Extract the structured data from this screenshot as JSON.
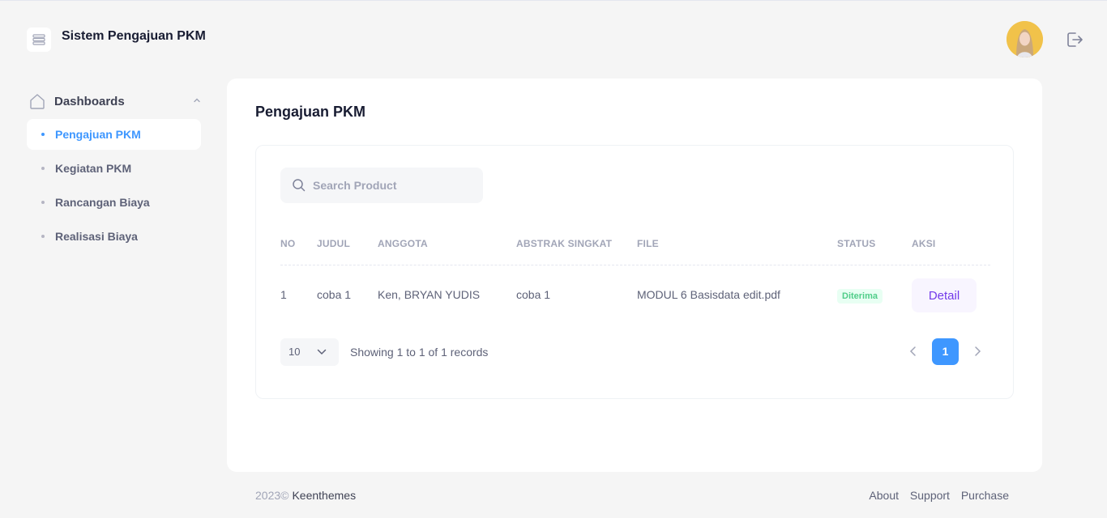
{
  "header": {
    "app_title": "Sistem Pengajuan PKM",
    "menu_icon": "menu-icon",
    "avatar_icon": "avatar",
    "logout_icon": "logout-icon"
  },
  "sidebar": {
    "section": {
      "label": "Dashboards",
      "icon": "home-icon"
    },
    "items": [
      {
        "label": "Pengajuan PKM",
        "active": true
      },
      {
        "label": "Kegiatan PKM",
        "active": false
      },
      {
        "label": "Rancangan Biaya",
        "active": false
      },
      {
        "label": "Realisasi Biaya",
        "active": false
      }
    ]
  },
  "main": {
    "title": "Pengajuan PKM",
    "search": {
      "placeholder": "Search Product",
      "value": ""
    },
    "table": {
      "headers": [
        "NO",
        "JUDUL",
        "ANGGOTA",
        "ABSTRAK SINGKAT",
        "FILE",
        "STATUS",
        "AKSI"
      ],
      "rows": [
        {
          "no": "1",
          "judul": "coba 1",
          "anggota": "Ken, BRYAN YUDIS",
          "abstrak": "coba 1",
          "file": "MODUL 6 Basisdata edit.pdf",
          "status": "Diterima",
          "aksi": "Detail"
        }
      ]
    },
    "pagination": {
      "page_size": "10",
      "records_text": "Showing 1 to 1 of 1 records",
      "current_page": "1"
    }
  },
  "footer": {
    "year": "2023©",
    "brand": "Keenthemes",
    "links": [
      "About",
      "Support",
      "Purchase"
    ]
  },
  "colors": {
    "accent": "#3e97ff",
    "success": "#50cd89",
    "detail": "#7239ea",
    "background": "#f5f5f5"
  }
}
